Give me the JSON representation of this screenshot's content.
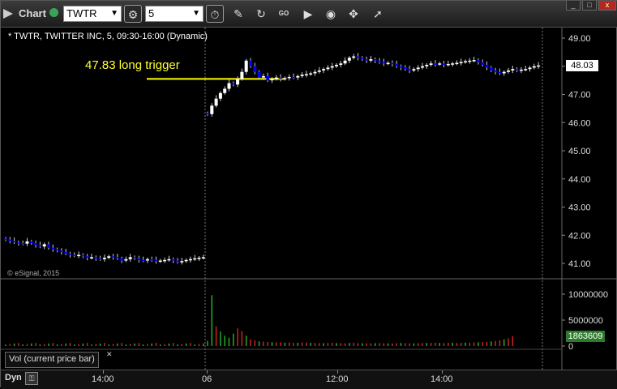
{
  "toolbar": {
    "title": "Chart",
    "symbol": "TWTR",
    "interval": "5",
    "go_label": "GO"
  },
  "window": {
    "close": "x",
    "max": "□",
    "min": "_"
  },
  "chart": {
    "legend": "* TWTR, TWITTER INC, 5, 09:30-16:00 (Dynamic)",
    "copyright": "© eSignal, 2015",
    "annotation": "47.83 long trigger",
    "current_price": "48.03",
    "volume_label": "Vol (current price bar)",
    "current_volume": "1863609",
    "bottom_label": "Dyn",
    "colors": {
      "up": "#ffffff",
      "down": "#0000ff",
      "trigger": "#ffff00",
      "vol_up": "#22aa22",
      "vol_down": "#cc2222"
    }
  },
  "chart_data": {
    "type": "candlestick",
    "price_axis": {
      "min": 40.8,
      "max": 49.1,
      "ticks": [
        "49.00",
        "48.00",
        "47.00",
        "46.00",
        "45.00",
        "44.00",
        "43.00",
        "42.00",
        "41.00"
      ]
    },
    "volume_axis": {
      "min": 0,
      "max": 11000000,
      "ticks": [
        "10000000",
        "5000000",
        "0"
      ]
    },
    "x_ticks": [
      "14:00",
      "06",
      "12:00",
      "14:00"
    ],
    "trigger_price": 47.55,
    "day1_close": [
      41.85,
      41.8,
      41.75,
      41.72,
      41.7,
      41.78,
      41.72,
      41.65,
      41.6,
      41.68,
      41.55,
      41.5,
      41.45,
      41.4,
      41.35,
      41.3,
      41.28,
      41.3,
      41.25,
      41.2,
      41.22,
      41.18,
      41.15,
      41.2,
      41.25,
      41.22,
      41.18,
      41.1,
      41.15,
      41.22,
      41.18,
      41.12,
      41.1,
      41.15,
      41.12,
      41.08,
      41.1,
      41.12,
      41.15,
      41.1,
      41.05,
      41.08,
      41.12,
      41.15,
      41.18,
      41.2,
      41.22
    ],
    "day2_close": [
      46.3,
      46.6,
      46.85,
      47.05,
      47.2,
      47.4,
      47.35,
      47.55,
      47.8,
      48.2,
      48.0,
      47.8,
      47.6,
      47.65,
      47.5,
      47.55,
      47.6,
      47.55,
      47.58,
      47.62,
      47.6,
      47.65,
      47.7,
      47.72,
      47.75,
      47.8,
      47.85,
      47.9,
      47.95,
      48.0,
      48.05,
      48.1,
      48.2,
      48.3,
      48.35,
      48.3,
      48.25,
      48.2,
      48.25,
      48.2,
      48.15,
      48.1,
      48.12,
      48.08,
      48.0,
      47.95,
      47.9,
      47.85,
      47.9,
      47.95,
      48.0,
      48.05,
      48.1,
      48.08,
      48.1,
      48.05,
      48.08,
      48.1,
      48.12,
      48.15,
      48.18,
      48.2,
      48.22,
      48.15,
      48.05,
      47.95,
      47.85,
      47.8,
      47.75,
      47.8,
      47.85,
      47.9,
      47.85,
      47.88,
      47.9,
      47.95,
      48.0,
      48.03
    ],
    "volume": [
      1000000,
      9800000,
      3800000,
      2800000,
      2000000,
      1600000,
      2400000,
      3400000,
      2900000,
      2000000,
      1300000,
      1100000,
      900000,
      850000,
      800000,
      750000,
      700000,
      720000,
      650000,
      690000,
      600000,
      640000,
      700000,
      660000,
      620000,
      600000,
      580000,
      560000,
      600000,
      620000,
      580000,
      560000,
      540000,
      600000,
      640000,
      580000,
      560000,
      540000,
      520000,
      560000,
      580000,
      540000,
      520000,
      500000,
      560000,
      600000,
      580000,
      540000,
      520000,
      560000,
      580000,
      600000,
      620000,
      640000,
      600000,
      580000,
      620000,
      640000,
      600000,
      620000,
      660000,
      640000,
      700000,
      720000,
      740000,
      800000,
      900000,
      1000000,
      1100000,
      1300000,
      1500000,
      1863609
    ]
  }
}
